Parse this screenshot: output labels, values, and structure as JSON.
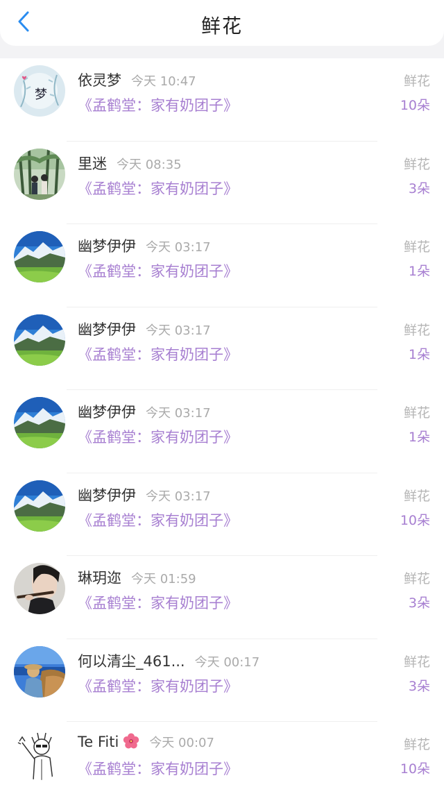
{
  "header": {
    "title": "鲜花",
    "back_icon": "chevron-left-icon",
    "accent": "#2a8cf0"
  },
  "colors": {
    "book_purple": "#a77fd1",
    "muted": "#b5b5b5"
  },
  "items": [
    {
      "name": "依灵梦",
      "time": "今天 10:47",
      "book": "《孟鹤堂：家有奶团子》",
      "label": "鲜花",
      "count": "10朵",
      "avatar": "avatar-dream-art"
    },
    {
      "name": "里迷",
      "time": "今天 08:35",
      "book": "《孟鹤堂：家有奶团子》",
      "label": "鲜花",
      "count": "3朵",
      "avatar": "avatar-forest-scene"
    },
    {
      "name": "幽梦伊伊",
      "time": "今天 03:17",
      "book": "《孟鹤堂：家有奶团子》",
      "label": "鲜花",
      "count": "1朵",
      "avatar": "avatar-mountain"
    },
    {
      "name": "幽梦伊伊",
      "time": "今天 03:17",
      "book": "《孟鹤堂：家有奶团子》",
      "label": "鲜花",
      "count": "1朵",
      "avatar": "avatar-mountain"
    },
    {
      "name": "幽梦伊伊",
      "time": "今天 03:17",
      "book": "《孟鹤堂：家有奶团子》",
      "label": "鲜花",
      "count": "1朵",
      "avatar": "avatar-mountain"
    },
    {
      "name": "幽梦伊伊",
      "time": "今天 03:17",
      "book": "《孟鹤堂：家有奶团子》",
      "label": "鲜花",
      "count": "10朵",
      "avatar": "avatar-mountain"
    },
    {
      "name": "琳玥迩",
      "time": "今天 01:59",
      "book": "《孟鹤堂：家有奶团子》",
      "label": "鲜花",
      "count": "3朵",
      "avatar": "avatar-flute-player"
    },
    {
      "name": "何以清尘_461...",
      "time": "今天 00:17",
      "book": "《孟鹤堂：家有奶团子》",
      "label": "鲜花",
      "count": "3朵",
      "avatar": "avatar-seaside"
    },
    {
      "name": "Te Fiti",
      "time": "今天 00:07",
      "book": "《孟鹤堂：家有奶团子》",
      "label": "鲜花",
      "count": "10朵",
      "avatar": "avatar-sketch",
      "badge": "hibiscus-icon"
    }
  ]
}
